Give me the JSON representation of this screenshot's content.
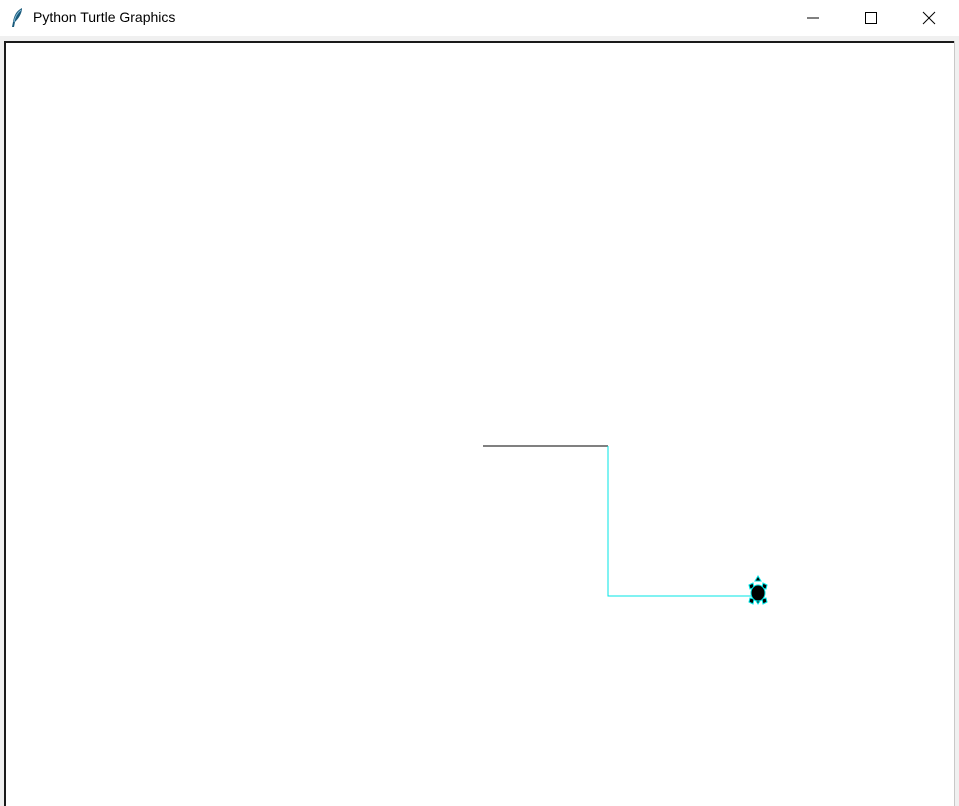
{
  "window": {
    "title": "Python Turtle Graphics",
    "icon": "feather-icon"
  },
  "controls": {
    "minimize_icon": "minimize-icon",
    "maximize_icon": "maximize-icon",
    "close_icon": "close-icon"
  },
  "canvas": {
    "background": "#ffffff",
    "colors": {
      "first_segment": "#000000",
      "pen": "#00e5e5",
      "turtle_fill": "#000000",
      "turtle_outline": "#00e5e5"
    },
    "turtle_heading": "up"
  }
}
